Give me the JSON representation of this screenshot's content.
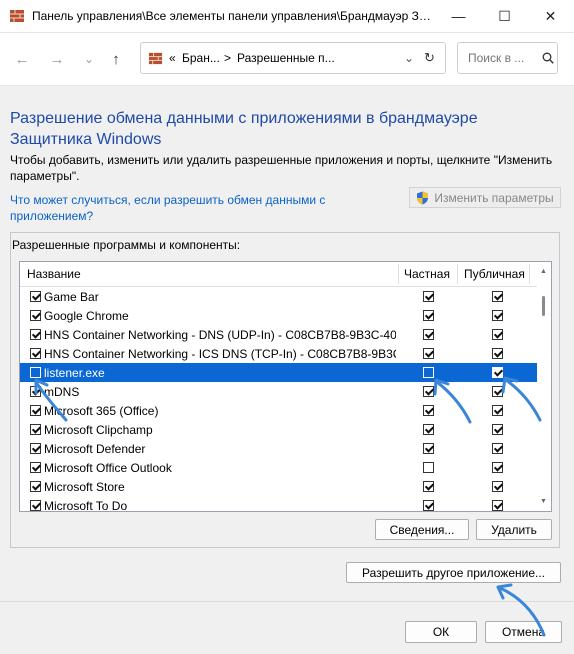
{
  "window": {
    "title": "Панель управления\\Все элементы панели управления\\Брандмауэр Защ...",
    "minimize_glyph": "—",
    "maximize_glyph": "☐",
    "close_glyph": "✕"
  },
  "nav": {
    "back_glyph": "←",
    "forward_glyph": "→",
    "history_glyph": "⌄",
    "up_glyph": "↑",
    "breadcrumb_overflow": "«",
    "breadcrumb_1": "Бран...",
    "breadcrumb_sep": ">",
    "breadcrumb_2": "Разрешенные п...",
    "address_dropdown_glyph": "⌄",
    "refresh_glyph": "↻",
    "search_placeholder": "Поиск в ...",
    "search_icon": "search-icon"
  },
  "page": {
    "heading": "Разрешение обмена данными с приложениями в брандмауэре Защитника Windows",
    "description": "Чтобы добавить, изменить или удалить разрешенные приложения и порты, щелкните \"Изменить параметры\".",
    "risk_link": "Что может случиться, если разрешить обмен данными с приложением?",
    "change_settings_label": "Изменить параметры",
    "group_label": "Разрешенные программы и компоненты:"
  },
  "table": {
    "columns": [
      "Название",
      "Частная",
      "Публичная"
    ],
    "rows": [
      {
        "name": "Game Bar",
        "enabled": true,
        "private": true,
        "public": true,
        "selected": false
      },
      {
        "name": "Google Chrome",
        "enabled": true,
        "private": true,
        "public": true,
        "selected": false
      },
      {
        "name": "HNS Container Networking - DNS (UDP-In) - C08CB7B8-9B3C-40...",
        "enabled": true,
        "private": true,
        "public": true,
        "selected": false
      },
      {
        "name": "HNS Container Networking - ICS DNS (TCP-In) - C08CB7B8-9B3C...",
        "enabled": true,
        "private": true,
        "public": true,
        "selected": false
      },
      {
        "name": "listener.exe",
        "enabled": false,
        "private": false,
        "public": true,
        "selected": true
      },
      {
        "name": "mDNS",
        "enabled": true,
        "private": true,
        "public": true,
        "selected": false
      },
      {
        "name": "Microsoft 365 (Office)",
        "enabled": true,
        "private": true,
        "public": true,
        "selected": false
      },
      {
        "name": "Microsoft Clipchamp",
        "enabled": true,
        "private": true,
        "public": true,
        "selected": false
      },
      {
        "name": "Microsoft Defender",
        "enabled": true,
        "private": true,
        "public": true,
        "selected": false
      },
      {
        "name": "Microsoft Office Outlook",
        "enabled": true,
        "private": false,
        "public": true,
        "selected": false
      },
      {
        "name": "Microsoft Store",
        "enabled": true,
        "private": true,
        "public": true,
        "selected": false
      },
      {
        "name": "Microsoft To Do",
        "enabled": true,
        "private": true,
        "public": true,
        "selected": false
      }
    ]
  },
  "buttons": {
    "details": "Сведения...",
    "delete": "Удалить",
    "allow_other": "Разрешить другое приложение...",
    "ok": "ОК",
    "cancel": "Отмена"
  },
  "colors": {
    "heading": "#1f4aa8",
    "link": "#0a62c8",
    "selection": "#0a67d3",
    "annotation_arrow": "#3a86d8"
  }
}
